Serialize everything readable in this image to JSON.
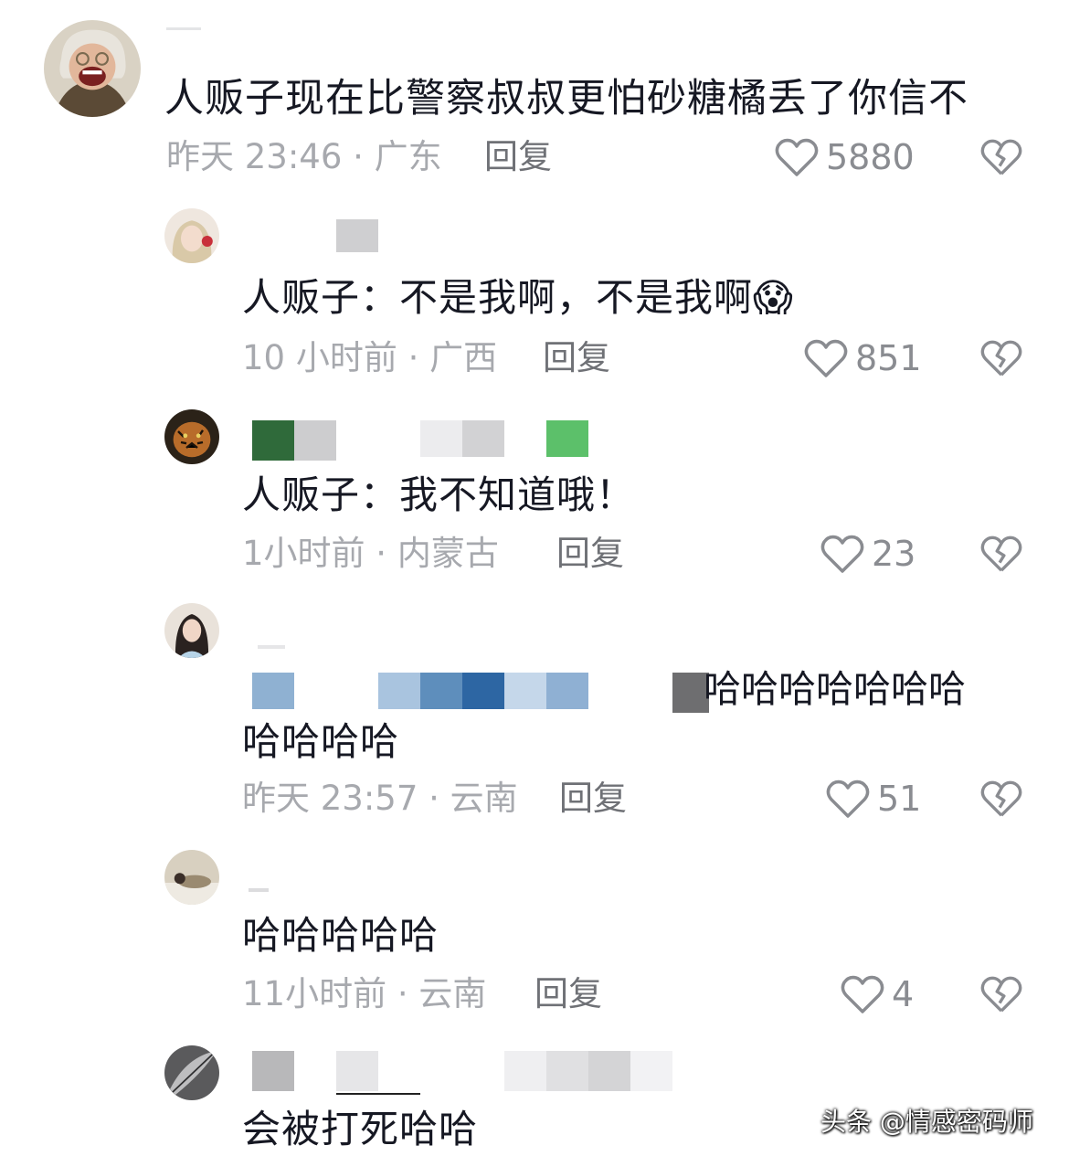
{
  "comments": [
    {
      "text": "人贩子现在比警察叔叔更怕砂糖橘丢了你信不",
      "meta": "昨天 23:46 · 广东",
      "reply": "回复",
      "likes": "5880",
      "avatar_icon": "laughing-person-avatar"
    },
    {
      "text": "人贩子：不是我啊，不是我啊😱",
      "meta": "10 小时前 · 广西",
      "reply": "回复",
      "likes": "851",
      "avatar_icon": "girl-avatar"
    },
    {
      "text": "人贩子：我不知道哦！",
      "meta": "1小时前 · 内蒙古",
      "reply": "回复",
      "likes": "23",
      "avatar_icon": "tiger-avatar"
    },
    {
      "text_line1": "哈哈哈哈哈哈哈",
      "text_line2": "哈哈哈哈",
      "meta": "昨天 23:57 · 云南",
      "reply": "回复",
      "likes": "51",
      "avatar_icon": "woman-avatar"
    },
    {
      "text": "哈哈哈哈哈",
      "meta": "11小时前 · 云南",
      "reply": "回复",
      "likes": "4",
      "avatar_icon": "person-lying-avatar"
    },
    {
      "text": "会被打死哈哈",
      "avatar_icon": "feather-avatar"
    }
  ],
  "watermark": "头条 @情感密码师",
  "colors": {
    "text": "#161823",
    "meta": "#a7a9ae",
    "icon": "#8a8c91"
  }
}
